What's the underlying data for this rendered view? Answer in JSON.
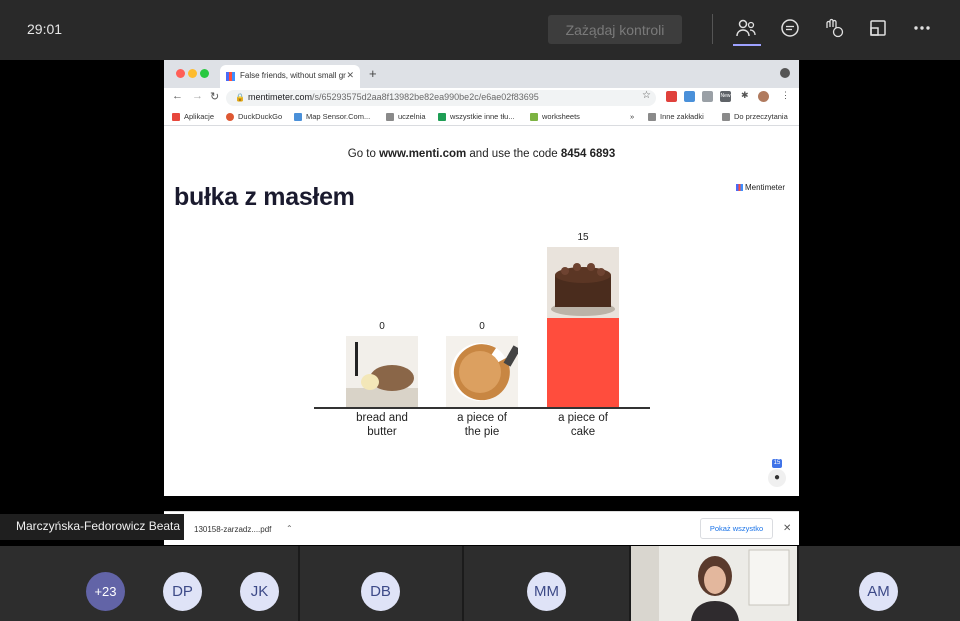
{
  "topbar": {
    "timer": "29:01",
    "request_control": "Zażądaj kontroli"
  },
  "browser": {
    "tab_title": "False friends, without small gr",
    "url_host": "menti meter.com",
    "url_main": "mentimeter.com",
    "url_path": "/s/65293575d2aa8f13982be82ea990be2c/e6ae02f83695",
    "ext_badge": "New",
    "bookmarks": [
      {
        "label": "Aplikacje",
        "color": "#e7473c"
      },
      {
        "label": "DuckDuckGo",
        "color": "#de5833"
      },
      {
        "label": "Map Sensor.Com...",
        "color": "#4a90d9"
      },
      {
        "label": "uczelnia",
        "color": "#8a8a8a"
      },
      {
        "label": "wszystkie inne tłu...",
        "color": "#1e9e55"
      },
      {
        "label": "worksheets",
        "color": "#7cb342"
      }
    ],
    "bookmarks_more": "»",
    "other_bookmarks": "Inne zakładki",
    "reading_list": "Do przeczytania"
  },
  "slide": {
    "join_prefix": "Go to ",
    "join_site": "www.menti.com",
    "join_middle": " and use the code ",
    "join_code": "8454 6893",
    "title": "bułka z masłem",
    "logo": "Mentimeter",
    "responses": "15"
  },
  "chart_data": {
    "type": "bar",
    "categories": [
      "bread and butter",
      "a piece of the pie",
      "a piece of cake"
    ],
    "values": [
      0,
      0,
      15
    ],
    "label_lines": [
      [
        "bread and",
        "butter"
      ],
      [
        "a piece of",
        "the pie"
      ],
      [
        "a piece of",
        "cake"
      ]
    ],
    "ylim": [
      0,
      15
    ],
    "bar_color": "#ff4d3d"
  },
  "download": {
    "file": "130158-zarzadz....pdf",
    "show_all": "Pokaż wszystko"
  },
  "presenter": "Marczyńska-Fedorowicz Beata",
  "participants": [
    {
      "initials": "+23"
    },
    {
      "initials": "DP"
    },
    {
      "initials": "JK"
    },
    {
      "initials": "DB"
    },
    {
      "initials": "MM"
    },
    {
      "initials": "AM"
    }
  ]
}
